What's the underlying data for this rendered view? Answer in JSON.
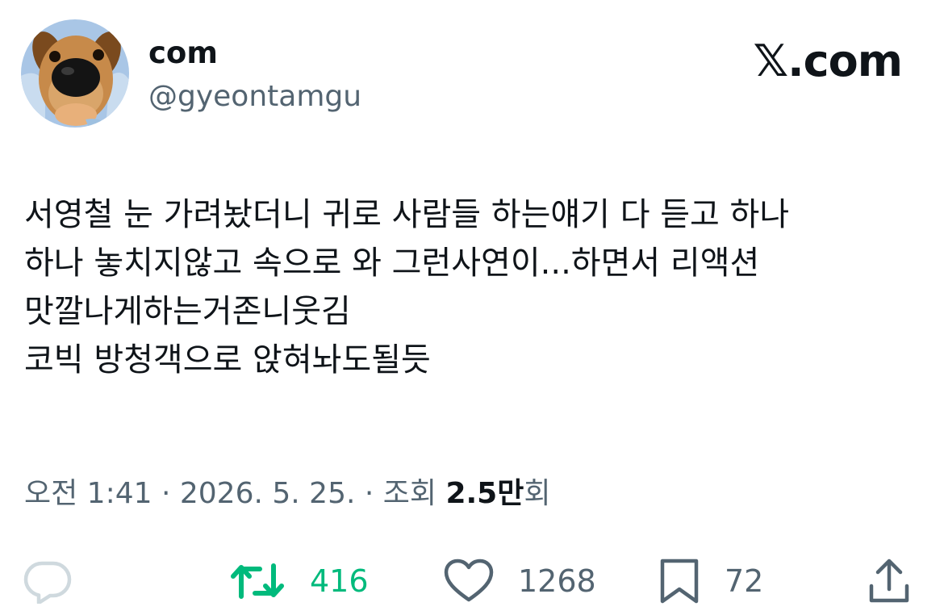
{
  "author": {
    "display_name": "com",
    "handle": "@gyeontamgu"
  },
  "brand": "𝕏.com",
  "tweet": {
    "lines": [
      "서영철 눈 가려놨더니 귀로 사람들 하는얘기 다 듣고 하나",
      "하나 놓치지않고 속으로 와 그런사연이...하면서 리액션",
      "맛깔나게하는거존니웃김",
      "코빅 방청객으로 앉혀놔도될듯"
    ]
  },
  "meta": {
    "time": "오전 1:41",
    "separator": " · ",
    "date": "2026. 5. 25.",
    "views_label": "조회 ",
    "views_number": "2.5만",
    "views_suffix": "회"
  },
  "actions": {
    "retweets": "416",
    "likes": "1268",
    "bookmarks": "72"
  },
  "colors": {
    "text": "#0f1419",
    "secondary": "#536471",
    "retweet": "#00ba7c",
    "reply_faded": "#cfd9de"
  },
  "icons": [
    "reply-icon",
    "retweet-icon",
    "heart-icon",
    "bookmark-icon",
    "share-icon"
  ]
}
